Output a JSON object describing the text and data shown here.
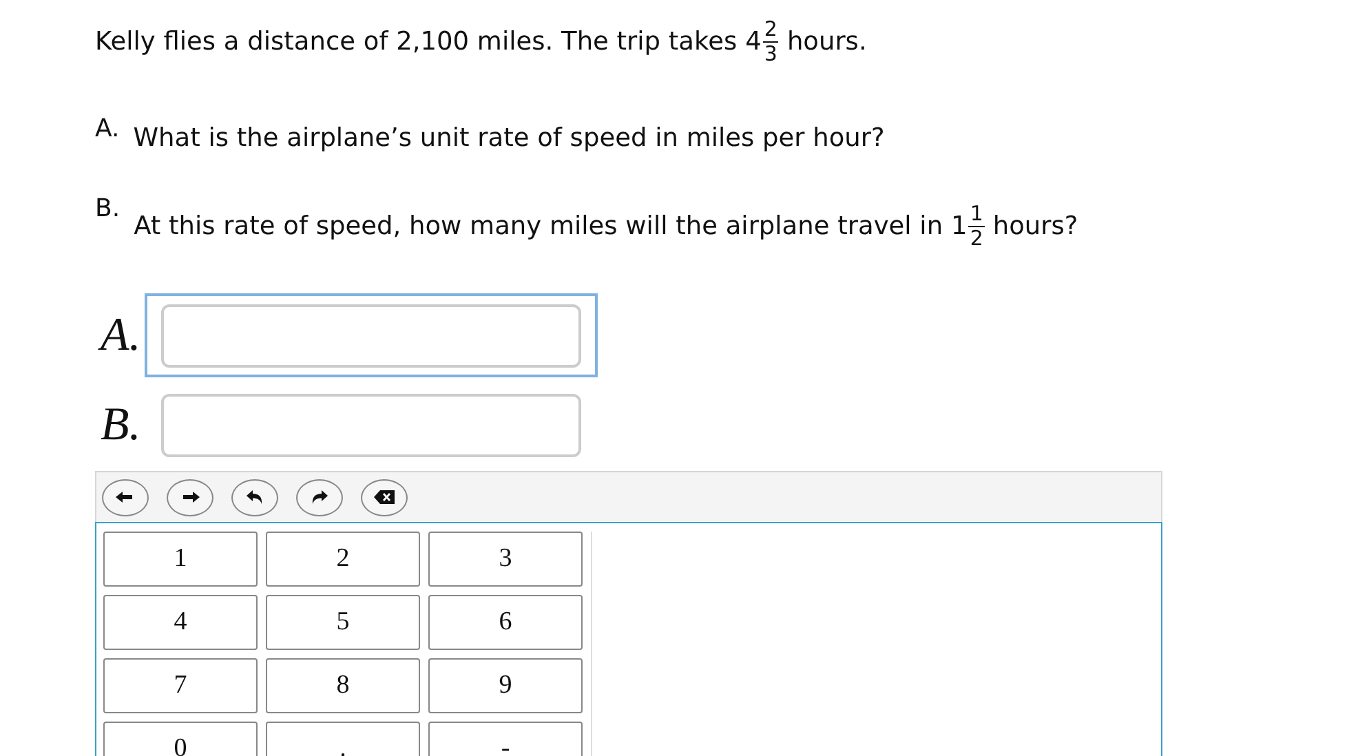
{
  "problem": {
    "text": "Kelly flies a distance of 2,100 miles. The trip takes",
    "fraction": {
      "whole": "4",
      "numerator": "2",
      "denominator": "3"
    },
    "after": "hours."
  },
  "questions": [
    {
      "label": "A.",
      "text": "What is the airplane’s unit rate of speed in miles per hour?"
    },
    {
      "label": "B.",
      "text": "At this rate of speed, how many miles will the airplane travel in",
      "fraction": {
        "whole": "1",
        "numerator": "1",
        "denominator": "2"
      },
      "after": "hours?"
    }
  ],
  "answers": [
    {
      "label": "A.",
      "focused": true
    },
    {
      "label": "B.",
      "focused": false
    }
  ],
  "keypad": [
    "1",
    "2",
    "3",
    "4",
    "5",
    "6",
    "7",
    "8",
    "9",
    "0",
    ".",
    "-"
  ]
}
